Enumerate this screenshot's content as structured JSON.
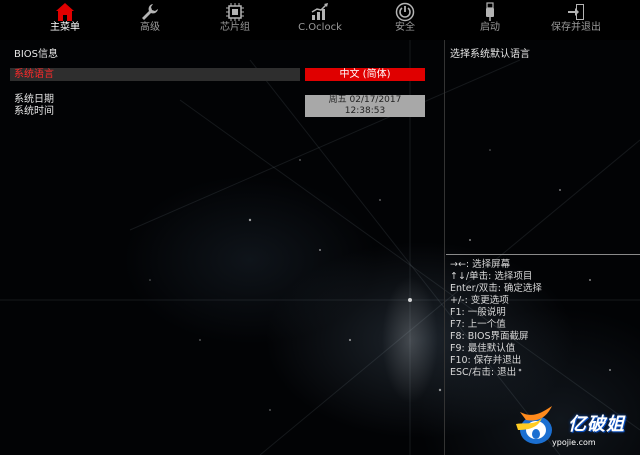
{
  "nav": {
    "items": [
      {
        "label": "主菜单",
        "icon": "home-icon",
        "active": true
      },
      {
        "label": "高级",
        "icon": "wrench-icon",
        "active": false
      },
      {
        "label": "芯片组",
        "icon": "chip-icon",
        "active": false
      },
      {
        "label": "C.Oclock",
        "icon": "overclock-chart-icon",
        "active": false
      },
      {
        "label": "安全",
        "icon": "security-power-icon",
        "active": false
      },
      {
        "label": "启动",
        "icon": "usb-boot-icon",
        "active": false
      },
      {
        "label": "保存并退出",
        "icon": "exit-door-icon",
        "active": false
      }
    ],
    "active_color": "#e00000",
    "icon_color": "#b4b4b4"
  },
  "main": {
    "section_title": "BIOS信息",
    "language": {
      "label": "系统语言",
      "value": "中文 (简体)"
    },
    "date": {
      "label": "系统日期",
      "value": "周五 02/17/2017"
    },
    "time": {
      "label": "系统时间",
      "value": "12:38:53"
    }
  },
  "help": {
    "description": "选择系统默认语言",
    "keys": [
      "→←: 选择屏幕",
      "↑↓/单击: 选择项目",
      "Enter/双击: 确定选择",
      "+/-: 变更选项",
      "F1: 一般说明",
      "F7: 上一个值",
      "F8: BIOS界面截屏",
      "F9: 最佳默认值",
      "F10: 保存并退出",
      "ESC/右击: 退出"
    ]
  },
  "watermark": {
    "logo_text": "亿破姐",
    "url_text": "ypojie.com"
  },
  "colors": {
    "highlight_red": "#e00000",
    "selected_label_red": "#ff2a2a",
    "field_grey": "#a8a8a8",
    "row_grey": "#2e2e2e",
    "background": "#000000"
  }
}
